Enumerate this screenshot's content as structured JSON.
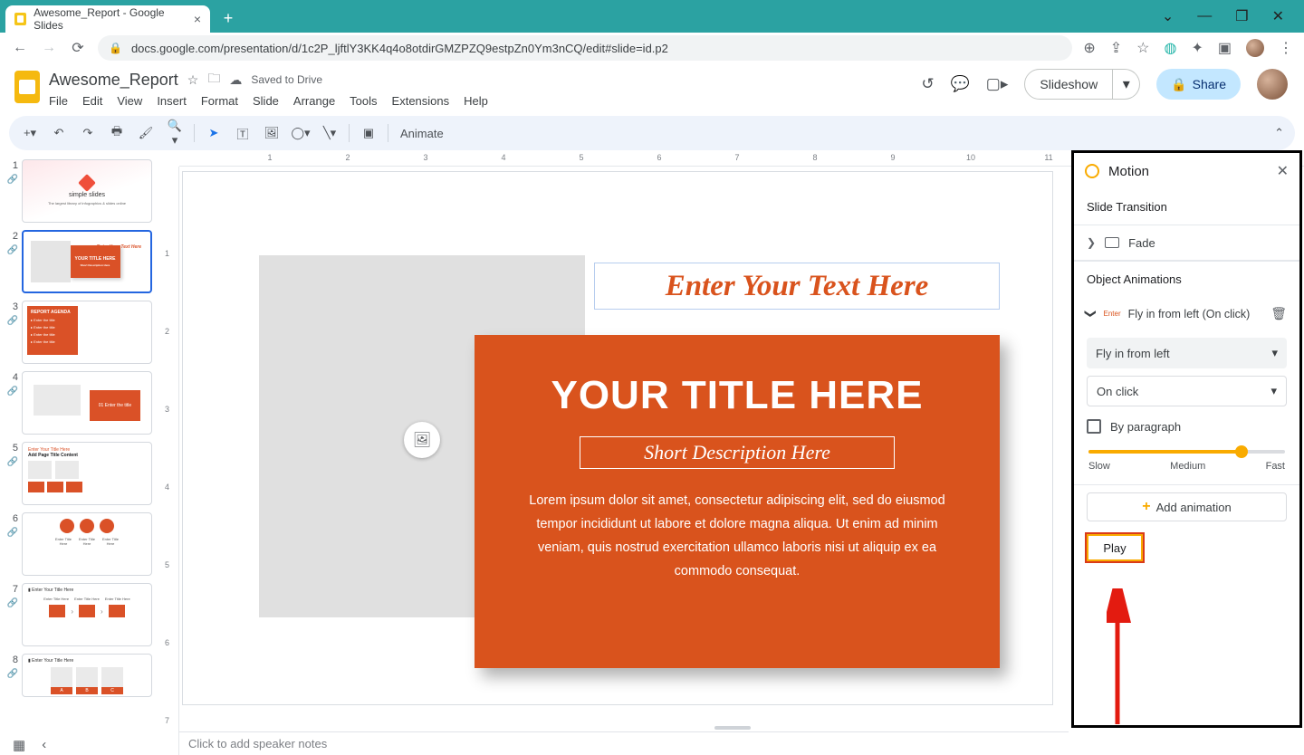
{
  "browser": {
    "tab_title": "Awesome_Report - Google Slides",
    "url": "docs.google.com/presentation/d/1c2P_ljftlY3KK4q4o8otdirGMZPZQ9estpZn0Ym3nCQ/edit#slide=id.p2"
  },
  "header": {
    "doc_title": "Awesome_Report",
    "saved_status": "Saved to Drive",
    "menus": [
      "File",
      "Edit",
      "View",
      "Insert",
      "Format",
      "Slide",
      "Arrange",
      "Tools",
      "Extensions",
      "Help"
    ],
    "slideshow": "Slideshow",
    "share": "Share"
  },
  "toolbar": {
    "animate": "Animate"
  },
  "ruler": {
    "hmarks": [
      "",
      "1",
      "2",
      "3",
      "4",
      "5",
      "6",
      "7",
      "8",
      "9",
      "10",
      "11"
    ],
    "vmarks": [
      "",
      "1",
      "2",
      "3",
      "4",
      "5",
      "6",
      "7"
    ]
  },
  "slide": {
    "enter_text": "Enter Your Text Here",
    "title": "YOUR TITLE HERE",
    "subtitle": "Short Description Here",
    "body": "Lorem ipsum dolor sit amet, consectetur adipiscing elit, sed do eiusmod tempor incididunt ut labore et dolore magna aliqua. Ut enim ad minim veniam, quis nostrud exercitation ullamco laboris nisi ut aliquip ex ea commodo consequat."
  },
  "notes": {
    "placeholder": "Click to add speaker notes"
  },
  "thumbs": {
    "t1a": "simple slides",
    "t1b": "The largest library of infographics & slides online",
    "t2a": "Enter Your Text Here",
    "t2b": "YOUR TITLE HERE",
    "t2c": "Short Description Here",
    "t3h": "REPORT AGENDA",
    "t3r": "Enter the title",
    "t4": "01 Enter the title",
    "t5a": "Enter Your Title Here",
    "t5b": "Add Page Title Content",
    "t6": "Enter Title Here",
    "t7": "Enter Your Title Here",
    "t7c": "Enter Title Here",
    "t8": "Enter Your Title Here"
  },
  "motion": {
    "title": "Motion",
    "slide_transition": "Slide Transition",
    "transition_type": "Fade",
    "object_animations": "Object Animations",
    "anim_tag": "Enter",
    "anim_desc": "Fly in from left  (On click)",
    "select_type": "Fly in from left",
    "select_trigger": "On click",
    "by_paragraph": "By paragraph",
    "slow": "Slow",
    "medium": "Medium",
    "fast": "Fast",
    "add_animation": "Add animation",
    "play": "Play"
  }
}
